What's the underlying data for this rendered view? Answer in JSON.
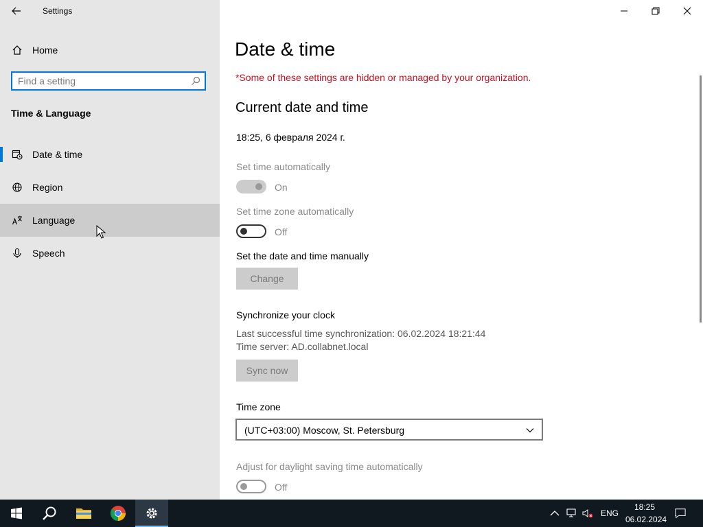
{
  "window": {
    "title": "Settings"
  },
  "sidebar": {
    "home_label": "Home",
    "search_placeholder": "Find a setting",
    "section_heading": "Time & Language",
    "items": [
      {
        "label": "Date & time",
        "icon": "calendar-clock-icon",
        "selected": true
      },
      {
        "label": "Region",
        "icon": "globe-icon",
        "selected": false
      },
      {
        "label": "Language",
        "icon": "language-icon",
        "selected": false,
        "hovered": true
      },
      {
        "label": "Speech",
        "icon": "microphone-icon",
        "selected": false
      }
    ]
  },
  "main": {
    "page_title": "Date & time",
    "org_warning": "*Some of these settings are hidden or managed by your organization.",
    "current_heading": "Current date and time",
    "current_value": "18:25, 6 февраля 2024 г.",
    "set_time_auto": {
      "label": "Set time automatically",
      "state": "On"
    },
    "set_tz_auto": {
      "label": "Set time zone automatically",
      "state": "Off"
    },
    "manual": {
      "label": "Set the date and time manually",
      "button": "Change"
    },
    "sync": {
      "heading": "Synchronize your clock",
      "last_sync": "Last successful time synchronization: 06.02.2024 18:21:44",
      "server": "Time server: AD.collabnet.local",
      "button": "Sync now"
    },
    "timezone": {
      "label": "Time zone",
      "value": "(UTC+03:00) Moscow, St. Petersburg"
    },
    "dst": {
      "label": "Adjust for daylight saving time automatically",
      "state": "Off"
    }
  },
  "taskbar": {
    "language": "ENG",
    "time": "18:25",
    "date": "06.02.2024"
  },
  "colors": {
    "accent": "#0078d7",
    "warning": "#c50f1f",
    "taskbar": "#101820"
  }
}
